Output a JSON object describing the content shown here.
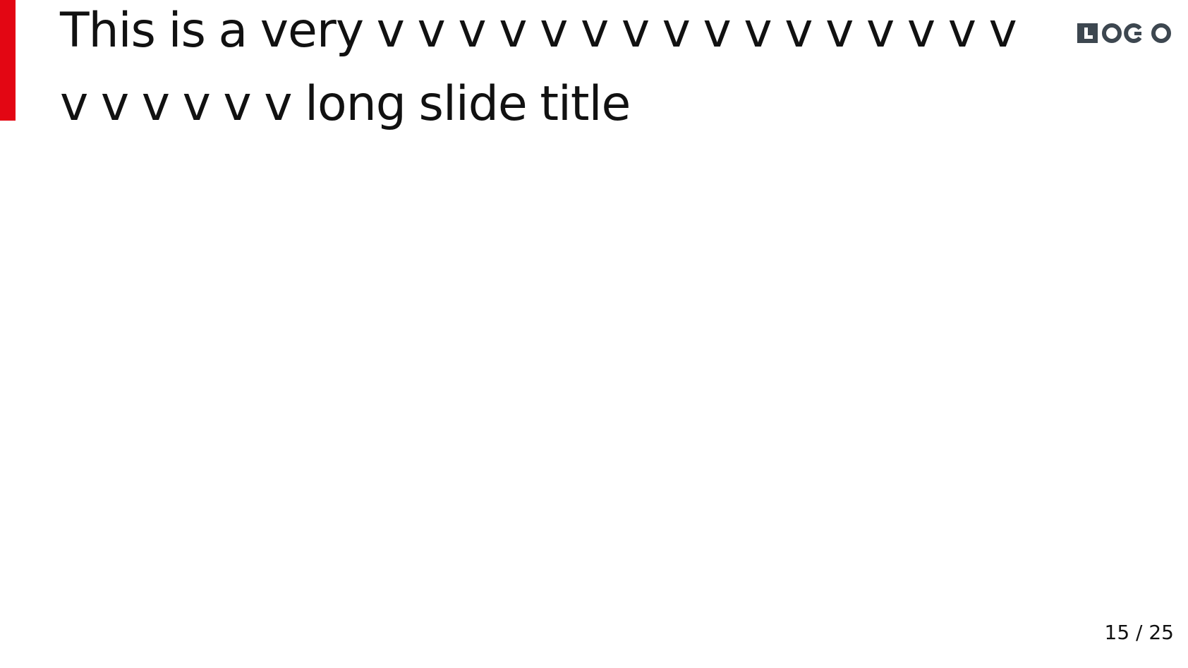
{
  "slide": {
    "title": "This is a very v v v v v v v v v v v v v v v v v v v v v v long slide title",
    "logo_text": "LOGO",
    "page_number": "15 / 25"
  },
  "colors": {
    "accent": "#e30613",
    "logo": "#3d4750",
    "text": "#111111",
    "background": "#ffffff"
  },
  "icons": {
    "logo": "logo-mark"
  }
}
